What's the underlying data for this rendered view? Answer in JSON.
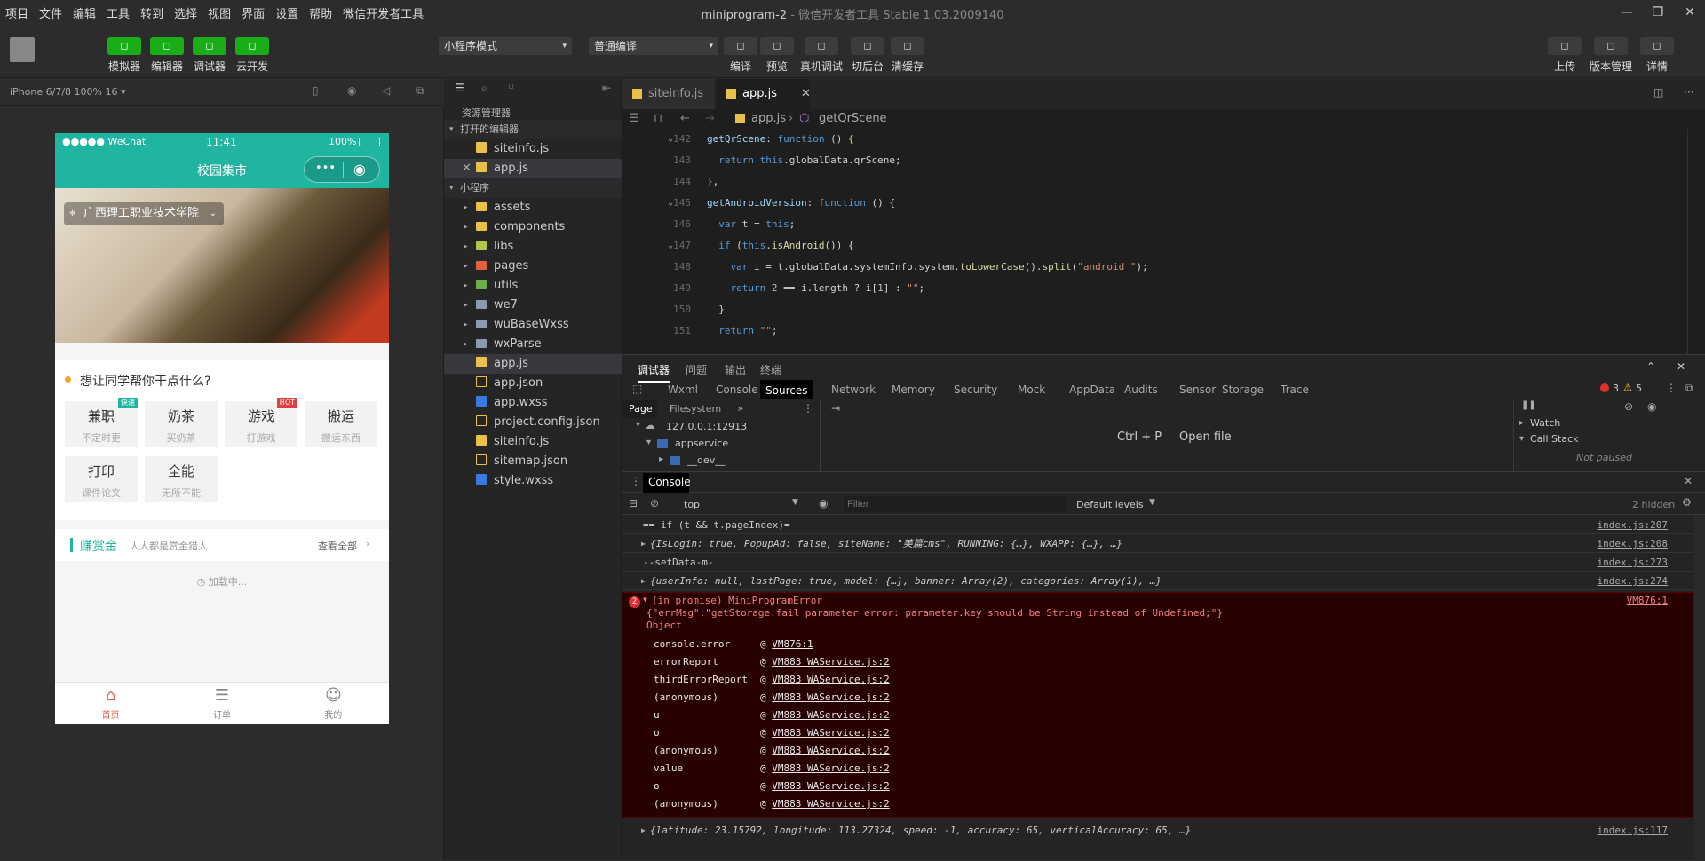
{
  "menu": [
    "项目",
    "文件",
    "编辑",
    "工具",
    "转到",
    "选择",
    "视图",
    "界面",
    "设置",
    "帮助",
    "微信开发者工具"
  ],
  "window_title": {
    "main": "miniprogram-2",
    "sub": " - 微信开发者工具 Stable 1.03.2009140"
  },
  "toolbar": {
    "left": [
      {
        "label": "模拟器",
        "icon": "phone-icon"
      },
      {
        "label": "编辑器",
        "icon": "code-icon"
      },
      {
        "label": "调试器",
        "icon": "debug-icon"
      },
      {
        "label": "云开发",
        "icon": "cloud-icon"
      }
    ],
    "mode_select": "小程序模式",
    "compile_select": "普通编译",
    "mid": [
      {
        "label": "编译",
        "icon": "refresh-icon"
      },
      {
        "label": "预览",
        "icon": "eye-icon"
      },
      {
        "label": "真机调试",
        "icon": "bug-icon"
      },
      {
        "label": "切后台",
        "icon": "switch-icon"
      },
      {
        "label": "清缓存",
        "icon": "layers-icon"
      }
    ],
    "right": [
      {
        "label": "上传",
        "icon": "upload-icon"
      },
      {
        "label": "版本管理",
        "icon": "branch-icon"
      },
      {
        "label": "详情",
        "icon": "menu-icon"
      }
    ]
  },
  "simulator": {
    "device": "iPhone 6/7/8 100% 16 ▾",
    "status": {
      "carrier": "●●●●● WeChat",
      "time": "11:41",
      "battery": "100%"
    },
    "nav_title": "校园集市",
    "location": "广西理工职业技术学院",
    "question": "想让同学帮你干点什么?",
    "cells": [
      {
        "title": "兼职",
        "sub": "不定时更",
        "badge": "快速",
        "badge_color": "#1fb5a0"
      },
      {
        "title": "奶茶",
        "sub": "买奶茶",
        "badge": "",
        "badge_color": ""
      },
      {
        "title": "游戏",
        "sub": "打游戏",
        "badge": "HOT",
        "badge_color": "#e04040"
      },
      {
        "title": "搬运",
        "sub": "搬运东西",
        "badge": "",
        "badge_color": ""
      },
      {
        "title": "打印",
        "sub": "课件论文",
        "badge": "",
        "badge_color": ""
      },
      {
        "title": "全能",
        "sub": "无所不能",
        "badge": "",
        "badge_color": ""
      }
    ],
    "bounty": {
      "title": "赚赏金",
      "desc": "人人都是赏金猎人",
      "more": "查看全部"
    },
    "loading": "加载中...",
    "tabs": [
      {
        "label": "首页",
        "active": true
      },
      {
        "label": "订单",
        "active": false
      },
      {
        "label": "我的",
        "active": false
      }
    ]
  },
  "explorer": {
    "title": "资源管理器",
    "open_editors_label": "打开的编辑器",
    "open_editors": [
      "siteinfo.js",
      "app.js"
    ],
    "project_label": "小程序",
    "folders": [
      {
        "name": "assets",
        "color": "#e8c04a"
      },
      {
        "name": "components",
        "color": "#e8c04a"
      },
      {
        "name": "libs",
        "color": "#b4c44a"
      },
      {
        "name": "pages",
        "color": "#e06040"
      },
      {
        "name": "utils",
        "color": "#6ab04a"
      },
      {
        "name": "we7",
        "color": "#8a9ab0"
      },
      {
        "name": "wuBaseWxss",
        "color": "#8a9ab0"
      },
      {
        "name": "wxParse",
        "color": "#8a9ab0"
      }
    ],
    "files": [
      {
        "name": "app.js",
        "type": "js"
      },
      {
        "name": "app.json",
        "type": "json"
      },
      {
        "name": "app.wxss",
        "type": "wxss"
      },
      {
        "name": "project.config.json",
        "type": "json"
      },
      {
        "name": "siteinfo.js",
        "type": "js"
      },
      {
        "name": "sitemap.json",
        "type": "json"
      },
      {
        "name": "style.wxss",
        "type": "wxss"
      }
    ]
  },
  "editor": {
    "tabs": [
      {
        "label": "siteinfo.js",
        "active": false
      },
      {
        "label": "app.js",
        "active": true
      }
    ],
    "breadcrumb": {
      "file": "app.js",
      "symbol": "getQrScene"
    },
    "lines": [
      {
        "n": "142",
        "html": "<span class='pr'>getQrScene</span>: <span class='kw'>function</span> () <span class='ye'>{</span>"
      },
      {
        "n": "143",
        "html": "&nbsp;&nbsp;<span class='kw'>return</span> <span class='kw'>this</span>.globalData.qrScene;"
      },
      {
        "n": "144",
        "html": "<span class='ye'>}</span>,"
      },
      {
        "n": "145",
        "html": "<span class='pr'>getAndroidVersion</span>: <span class='kw'>function</span> () {"
      },
      {
        "n": "146",
        "html": "&nbsp;&nbsp;<span class='kw'>var</span> t = <span class='kw'>this</span>;"
      },
      {
        "n": "147",
        "html": "&nbsp;&nbsp;<span class='kw'>if</span> (<span class='kw'>this</span>.<span class='fn'>isAndroid</span>()) {"
      },
      {
        "n": "148",
        "html": "&nbsp;&nbsp;&nbsp;&nbsp;<span class='kw'>var</span> i = t.globalData.systemInfo.system.<span class='fn'>toLowerCase</span>().<span class='fn'>split</span>(<span class='st'>\"android \"</span>);"
      },
      {
        "n": "149",
        "html": "&nbsp;&nbsp;&nbsp;&nbsp;<span class='kw'>return</span> <span class='nu'>2</span> == i.length ? i[<span class='nu'>1</span>] : <span class='st'>\"\"</span>;"
      },
      {
        "n": "150",
        "html": "&nbsp;&nbsp;}"
      },
      {
        "n": "151",
        "html": "&nbsp;&nbsp;<span class='kw'>return</span> <span class='st'>\"\"</span>;"
      }
    ]
  },
  "devtools": {
    "top_tabs": [
      "调试器",
      "问题",
      "输出",
      "终端"
    ],
    "panel_tabs": [
      "Wxml",
      "Console",
      "Sources",
      "Network",
      "Memory",
      "Security",
      "Mock",
      "AppData",
      "Audits",
      "Sensor",
      "Storage",
      "Trace"
    ],
    "active_panel": "Sources",
    "errors": "3",
    "warnings": "5",
    "sources": {
      "tabs": [
        "Page",
        "Filesystem"
      ],
      "host": "127.0.0.1:12913",
      "service": "appservice",
      "dev": "__dev__",
      "shortcut": "Ctrl + P",
      "shortcut_label": "Open file",
      "watch": "Watch",
      "callstack": "Call Stack",
      "not_paused": "Not paused"
    },
    "console": {
      "tab": "Console",
      "context": "top",
      "filter_placeholder": "Filter",
      "levels": "Default levels",
      "hidden": "2 hidden",
      "lines": [
        {
          "text": "== if (t && t.pageIndex)=",
          "src": "index.js:207",
          "expand": false
        },
        {
          "text": "{IsLogin: true, PopupAd: false, siteName: \"美篇cms\", RUNNING: {…}, WXAPP: {…}, …}",
          "src": "index.js:208",
          "expand": true
        },
        {
          "text": "--setData-m-",
          "src": "index.js:273",
          "expand": false
        },
        {
          "text": "{userInfo: null, lastPage: true, model: {…}, banner: Array(2), categories: Array(1), …}",
          "src": "index.js:274",
          "expand": true
        }
      ],
      "error": {
        "count": "2",
        "head": "(in promise) MiniProgramError",
        "src": "VM876:1",
        "msg": "{\"errMsg\":\"getStorage:fail parameter error: parameter.key should be String instead of Undefined;\"}",
        "obj": "Object",
        "stack": [
          {
            "fn": "console.error",
            "loc": "VM876:1"
          },
          {
            "fn": "errorReport",
            "loc": "VM883 WAService.js:2"
          },
          {
            "fn": "thirdErrorReport",
            "loc": "VM883 WAService.js:2"
          },
          {
            "fn": "(anonymous)",
            "loc": "VM883 WAService.js:2"
          },
          {
            "fn": "u",
            "loc": "VM883 WAService.js:2"
          },
          {
            "fn": "o",
            "loc": "VM883 WAService.js:2"
          },
          {
            "fn": "(anonymous)",
            "loc": "VM883 WAService.js:2"
          },
          {
            "fn": "value",
            "loc": "VM883 WAService.js:2"
          },
          {
            "fn": "o",
            "loc": "VM883 WAService.js:2"
          },
          {
            "fn": "(anonymous)",
            "loc": "VM883 WAService.js:2"
          }
        ]
      },
      "last": {
        "text": "{latitude: 23.15792, longitude: 113.27324, speed: -1, accuracy: 65, verticalAccuracy: 65, …}",
        "src": "index.js:117"
      }
    }
  }
}
